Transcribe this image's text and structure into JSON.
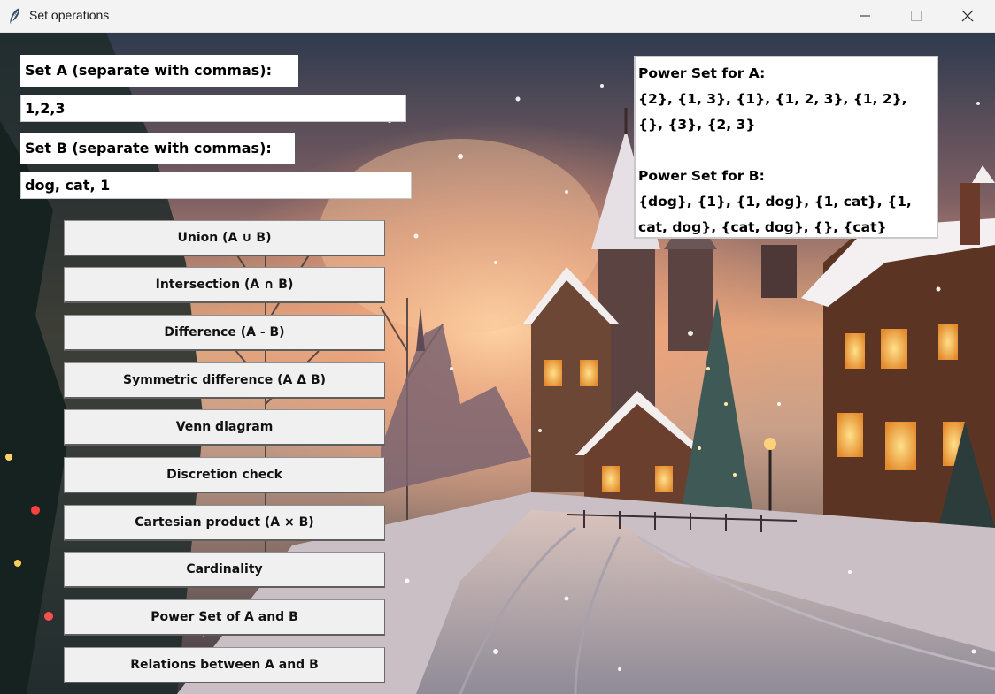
{
  "window": {
    "title": "Set operations"
  },
  "form": {
    "set_a_label": "Set A (separate with commas):",
    "set_a_value": "1,2,3",
    "set_b_label": "Set B (separate with commas):",
    "set_b_value": "dog, cat, 1"
  },
  "buttons": {
    "union": "Union (A ∪ B)",
    "intersection": "Intersection (A ∩ B)",
    "difference": "Difference (A - B)",
    "symmetric_difference": "Symmetric difference (A Δ B)",
    "venn": "Venn diagram",
    "discretion": "Discretion check",
    "cartesian": "Cartesian product (A × B)",
    "cardinality": "Cardinality",
    "power_set": "Power Set of A and B",
    "relations": "Relations between A and B"
  },
  "output": {
    "a_heading": "Power Set for A:",
    "a_content": "{2}, {1, 3}, {1}, {1, 2, 3}, {1, 2}, {}, {3}, {2, 3}",
    "b_heading": "Power Set for B:",
    "b_content": "{dog}, {1}, {1, dog}, {1, cat}, {1, cat, dog}, {cat, dog}, {}, {cat}"
  },
  "colors": {
    "button_face": "#f0f0f0",
    "titlebar": "#f3f3f3",
    "widget_bg": "#ffffff"
  },
  "icons": {
    "app": "feather-icon",
    "minimize": "minimize-icon",
    "maximize": "maximize-icon",
    "close": "close-icon"
  }
}
